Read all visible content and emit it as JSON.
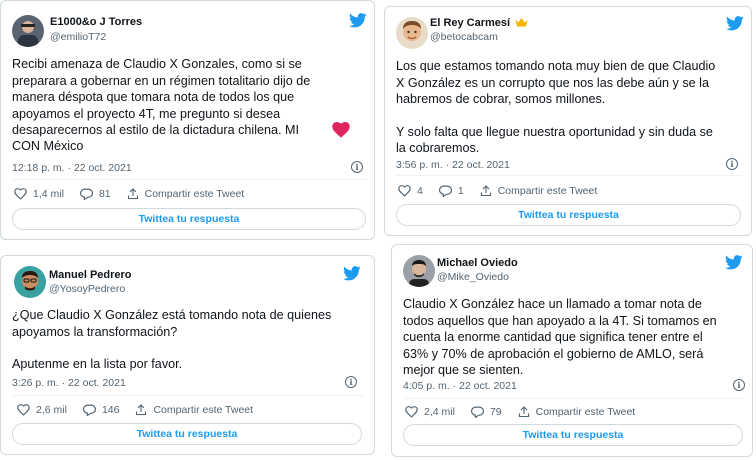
{
  "tweets": [
    {
      "name": "E1000&o J Torres",
      "handle": "@emilioT72",
      "text": "Recibi amenaza de Claudio X Gonzales, como si se\npreparara a gobernar en un régimen totalitario dijo de\nmanera déspota que tomara nota de todos los que\napoyamos el proyecto 4T, me pregunto si desea\ndesaparecernos al estilo de la dictadura chilena.  MI",
      "text_tail": "CON México",
      "emoji": "red-heart",
      "time": "12:18 p. m. · 22 oct. 2021",
      "likes": "1,4 mil",
      "replies": "81",
      "share": "Compartir este Tweet",
      "reply_button": "Twittea tu respuesta"
    },
    {
      "name": "El Rey Carmesí",
      "name_emoji": "crown",
      "handle": "@betocabcam",
      "text": "Los que estamos tomando nota muy bien de que Claudio\nX González es un corrupto que nos las debe aún y se la\nhabremos de cobrar, somos millones.",
      "text2": "Y solo falta que llegue nuestra oportunidad y sin duda se\nla cobraremos.",
      "time": "3:56 p. m. · 22 oct. 2021",
      "likes": "4",
      "replies": "1",
      "share": "Compartir este Tweet",
      "reply_button": "Twittea tu respuesta"
    },
    {
      "name": "Manuel Pedrero",
      "handle": "@YosoyPedrero",
      "text": "¿Que Claudio X González está tomando nota de quienes\napoyamos la transformación?",
      "text2": "Aputenme en la lista por favor.",
      "time": "3:26 p. m. · 22 oct. 2021",
      "likes": "2,6 mil",
      "replies": "146",
      "share": "Compartir este Tweet",
      "reply_button": "Twittea tu respuesta"
    },
    {
      "name": "Michael Oviedo",
      "handle": "@Mike_Oviedo",
      "text": "Claudio X González hace un llamado a tomar nota de\ntodos aquellos que han apoyado a la 4T. Si tomamos en\ncuenta la enorme cantidad que significa tener entre el\n63% y 70% de aprobación el gobierno de AMLO, será\nmejor que se sienten.",
      "time": "4:05 p. m. · 22 oct. 2021",
      "likes": "2,4 mil",
      "replies": "79",
      "share": "Compartir este Tweet",
      "reply_button": "Twittea tu respuesta"
    }
  ],
  "colors": {
    "twitter_blue": "#1d9bf0",
    "text": "#0f1419",
    "muted": "#536471",
    "heart": "#f91880"
  },
  "icons": [
    "twitter-bird-icon",
    "heart-icon",
    "reply-icon",
    "share-icon",
    "info-icon"
  ]
}
